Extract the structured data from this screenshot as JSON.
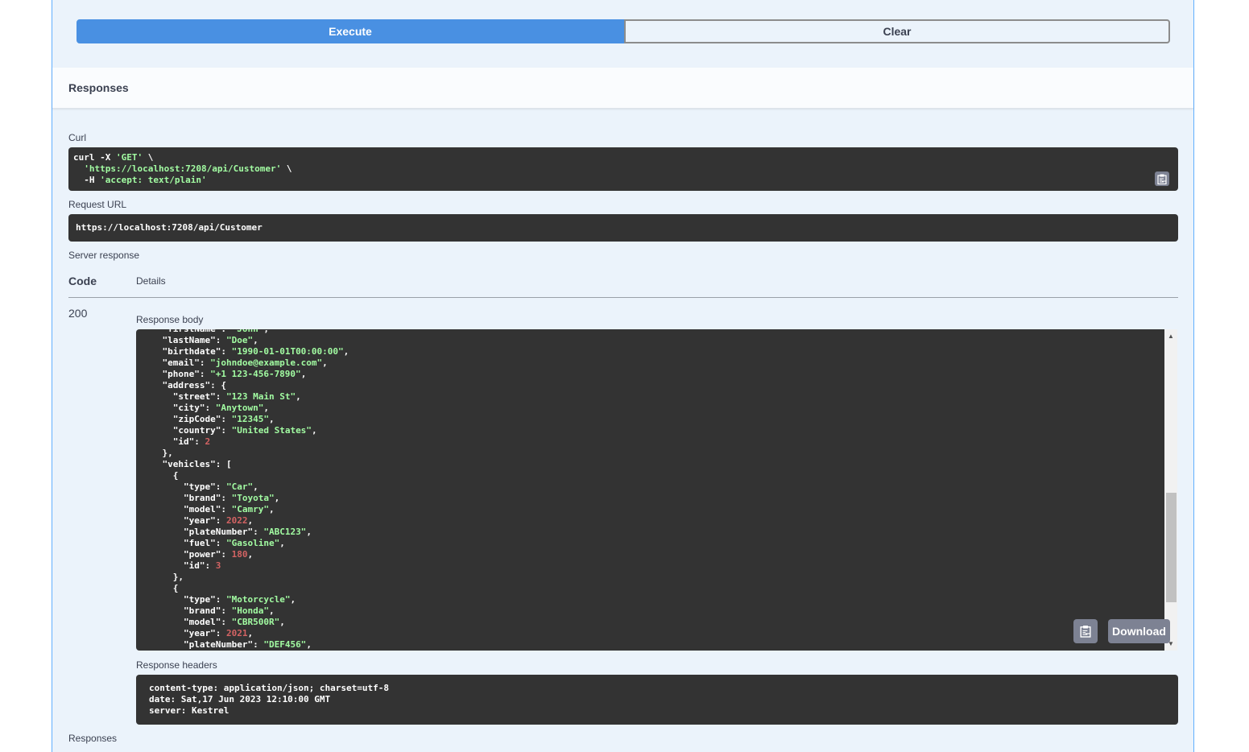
{
  "buttons": {
    "execute": "Execute",
    "clear": "Clear"
  },
  "responses_header": "Responses",
  "curl": {
    "label": "Curl",
    "lines": [
      [
        "curl -X ",
        "'GET'",
        " \\"
      ],
      [
        "  ",
        "'https://localhost:7208/api/Customer'",
        " \\"
      ],
      [
        "  -H ",
        "'accept: text/plain'",
        ""
      ]
    ]
  },
  "request_url": {
    "label": "Request URL",
    "value": "https://localhost:7208/api/Customer"
  },
  "server_response": {
    "label": "Server response",
    "code_header": "Code",
    "details_header": "Details",
    "code": "200"
  },
  "response_body": {
    "label": "Response body",
    "download": "Download",
    "lines": [
      "[",
      "  {",
      "    \"firstName\": \"John\",",
      "    \"lastName\": \"Doe\",",
      "    \"birthdate\": \"1990-01-01T00:00:00\",",
      "    \"email\": \"johndoe@example.com\",",
      "    \"phone\": \"+1 123-456-7890\",",
      "    \"address\": {",
      "      \"street\": \"123 Main St\",",
      "      \"city\": \"Anytown\",",
      "      \"zipCode\": \"12345\",",
      "      \"country\": \"United States\",",
      "      \"id\": 2",
      "    },",
      "    \"vehicles\": [",
      "      {",
      "        \"type\": \"Car\",",
      "        \"brand\": \"Toyota\",",
      "        \"model\": \"Camry\",",
      "        \"year\": 2022,",
      "        \"plateNumber\": \"ABC123\",",
      "        \"fuel\": \"Gasoline\",",
      "        \"power\": 180,",
      "        \"id\": 3",
      "      },",
      "      {",
      "        \"type\": \"Motorcycle\",",
      "        \"brand\": \"Honda\",",
      "        \"model\": \"CBR500R\",",
      "        \"year\": 2021,",
      "        \"plateNumber\": \"DEF456\","
    ]
  },
  "response_headers": {
    "label": "Response headers",
    "lines": [
      "content-type: application/json; charset=utf-8",
      "date: Sat,17 Jun 2023 12:10:00 GMT",
      "server: Kestrel"
    ]
  },
  "footer_label": "Responses",
  "colors": {
    "execute": "#4990e2",
    "code_bg": "#333333",
    "string": "#a2fca2",
    "number": "#d36363"
  }
}
